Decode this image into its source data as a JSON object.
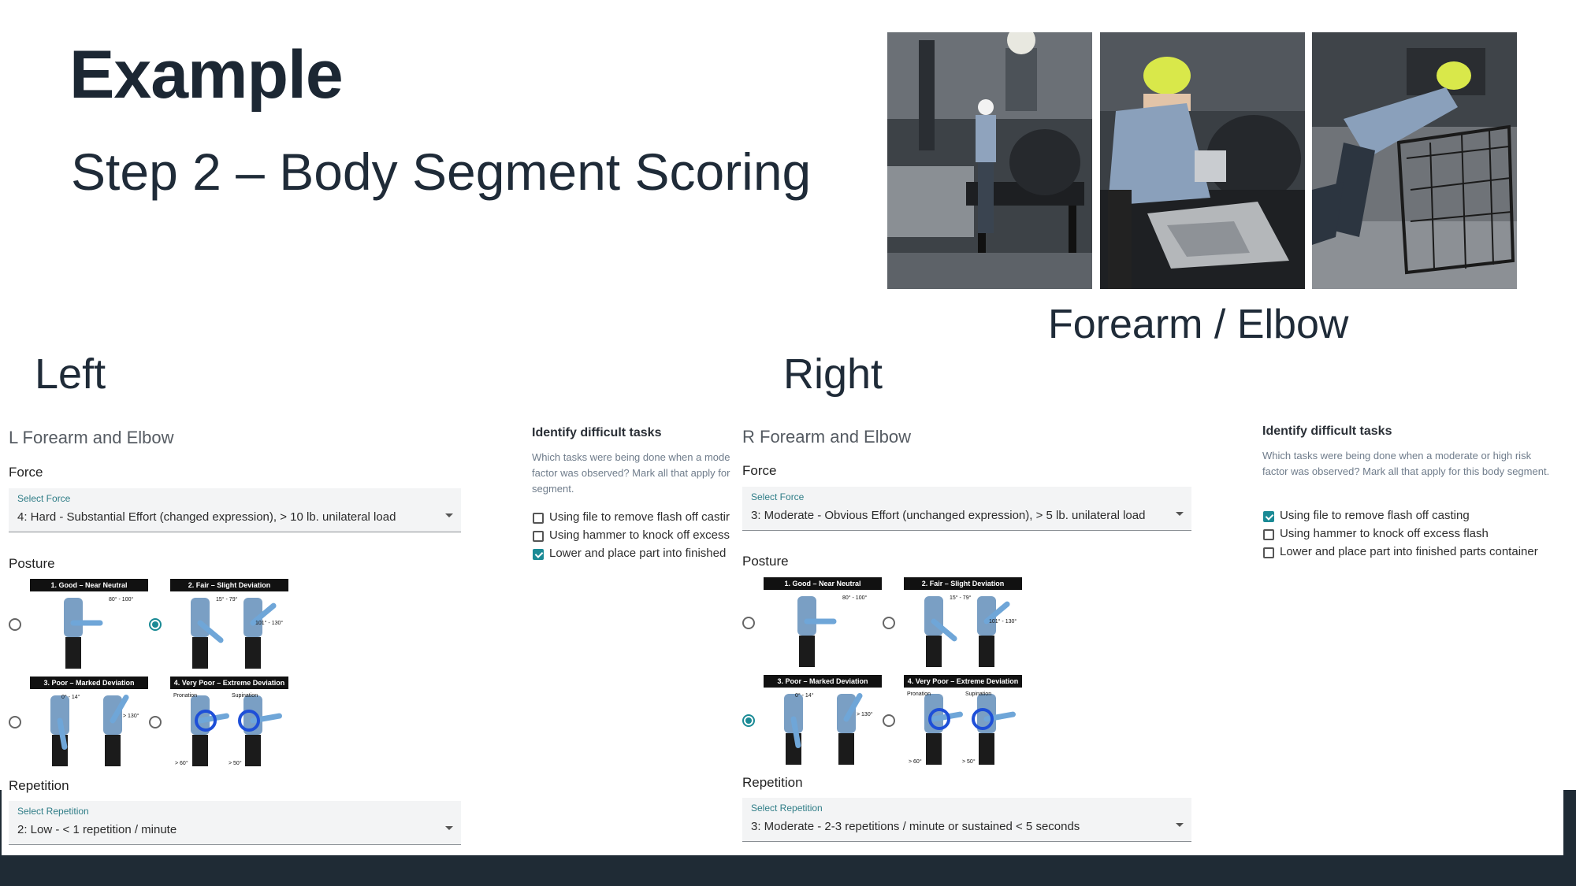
{
  "slide": {
    "title": "Example",
    "subtitle": "Step 2 – Body Segment Scoring",
    "section_label": "Forearm / Elbow"
  },
  "left": {
    "side_label": "Left",
    "panel_title": "L Forearm and Elbow",
    "force": {
      "label": "Force",
      "select_caption": "Select Force",
      "value": "4: Hard - Substantial Effort (changed expression), > 10 lb. unilateral load"
    },
    "posture": {
      "label": "Posture",
      "selected": 2
    },
    "repetition": {
      "label": "Repetition",
      "select_caption": "Select Repetition",
      "value": "2: Low - < 1 repetition / minute"
    },
    "tasks": {
      "title": "Identify difficult tasks",
      "help": "Which tasks were being done when a mode factor was observed? Mark all that apply for segment.",
      "items": [
        {
          "label": "Using file to remove flash off castir",
          "checked": false
        },
        {
          "label": "Using hammer to knock off excess",
          "checked": false
        },
        {
          "label": "Lower and place part into finished",
          "checked": true
        }
      ]
    }
  },
  "right": {
    "side_label": "Right",
    "panel_title": "R Forearm and Elbow",
    "force": {
      "label": "Force",
      "select_caption": "Select Force",
      "value": "3: Moderate - Obvious Effort (unchanged expression), > 5 lb. unilateral load"
    },
    "posture": {
      "label": "Posture",
      "selected": 3
    },
    "repetition": {
      "label": "Repetition",
      "select_caption": "Select Repetition",
      "value": "3: Moderate - 2-3 repetitions / minute or sustained < 5 seconds"
    },
    "tasks": {
      "title": "Identify difficult tasks",
      "help": "Which tasks were being done when a moderate or high risk factor was observed? Mark all that apply for this body segment.",
      "items": [
        {
          "label": "Using file to remove flash off casting",
          "checked": true
        },
        {
          "label": "Using hammer to knock off excess flash",
          "checked": false
        },
        {
          "label": "Lower and place part into finished parts container",
          "checked": false
        }
      ]
    }
  },
  "posture_options": [
    {
      "title": "1. Good – Near Neutral",
      "notes": [
        "80° - 100°"
      ]
    },
    {
      "title": "2. Fair – Slight Deviation",
      "notes": [
        "15° - 79°",
        "101° - 130°"
      ]
    },
    {
      "title": "3. Poor – Marked Deviation",
      "notes": [
        "0° - 14°",
        "> 130°"
      ]
    },
    {
      "title": "4. Very Poor – Extreme Deviation",
      "notes": [
        "Pronation",
        "Supination",
        "> 60°",
        "> 50°"
      ]
    }
  ],
  "icons": {
    "select_arrow": "caret-down-icon",
    "checkbox": "checkbox-icon",
    "radio": "radio-icon"
  },
  "colors": {
    "accent": "#1a8a95",
    "title": "#1c2733",
    "footer": "#1f2b35"
  }
}
